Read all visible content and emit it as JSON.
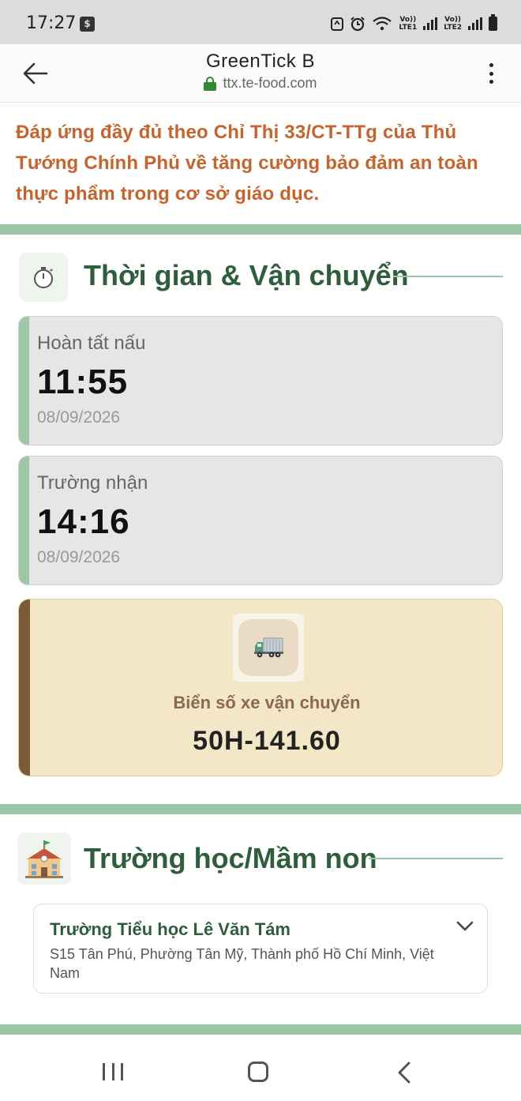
{
  "status_bar": {
    "time": "17:27",
    "lte1": "Vo))\nLTE1",
    "lte2": "Vo))\nLTE2"
  },
  "browser": {
    "title": "GreenTick B",
    "url": "ttx.te-food.com"
  },
  "notice": "Đáp ứng đầy đủ theo Chỉ Thị 33/CT-TTg của Thủ Tướng Chính Phủ về tăng cường bảo đảm an toàn thực phẩm trong cơ sở giáo dục.",
  "timing_section": {
    "title": "Thời gian & Vận chuyển",
    "icon": "stopwatch-icon",
    "cooking": {
      "label": "Hoàn tất nấu",
      "time": "11:55",
      "date": "08/09/2026"
    },
    "received": {
      "label": "Trường nhận",
      "time": "14:16",
      "date": "08/09/2026"
    },
    "vehicle": {
      "icon": "truck-icon",
      "label": "Biển số xe vận chuyển",
      "plate": "50H-141.60"
    }
  },
  "school_section": {
    "title": "Trường học/Mầm non",
    "icon": "school-icon",
    "school_name": "Trường Tiểu học Lê Văn Tám",
    "school_address": "S15 Tân Phú, Phường Tân Mỹ, Thành phố Hồ Chí Minh, Việt Nam"
  },
  "colors": {
    "notice_orange": "#c9622b",
    "section_green": "#2f5e3c",
    "divider_green": "#9cc5a5",
    "vehicle_bg": "#f3e7c8",
    "vehicle_accent": "#7b5b37"
  }
}
